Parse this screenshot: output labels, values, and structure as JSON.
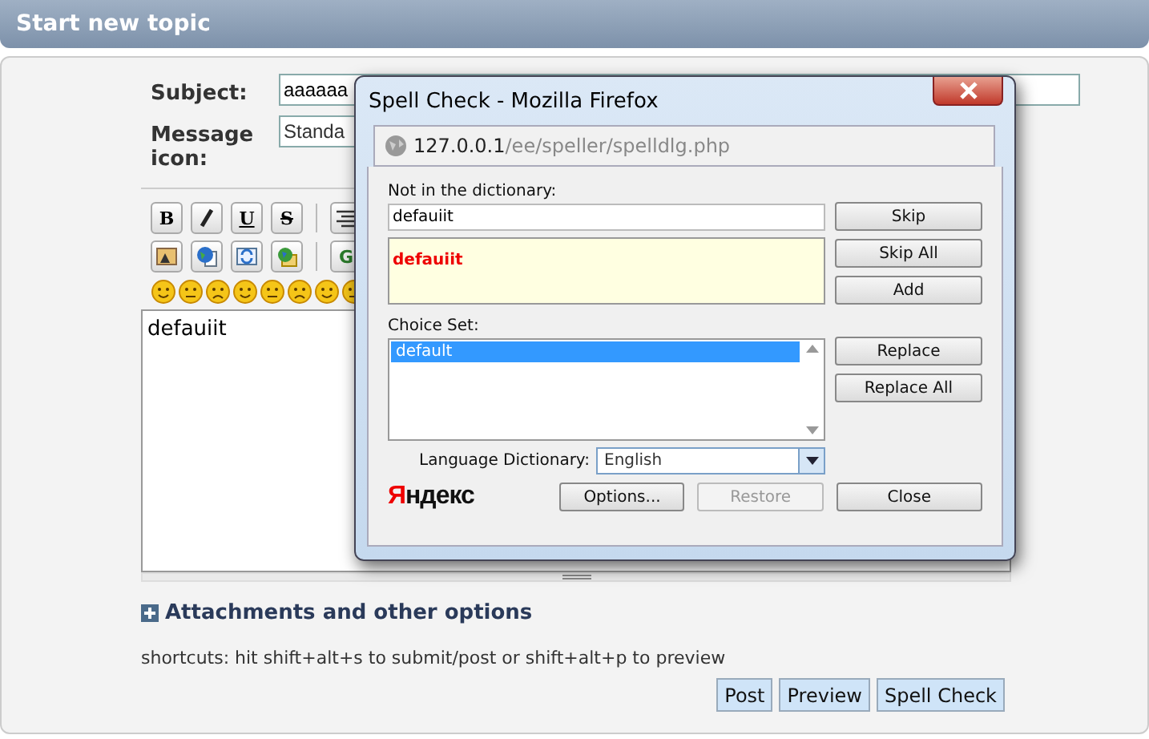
{
  "header": {
    "title": "Start new topic"
  },
  "form": {
    "subject_label": "Subject:",
    "subject_value": "aaaaaa",
    "icon_label": "Message icon:",
    "icon_value": "Standa"
  },
  "toolbar": {
    "format_buttons": [
      "B",
      "U",
      "S"
    ],
    "letter_button": "G"
  },
  "editor": {
    "value": "defauiit"
  },
  "attachments": {
    "label": "Attachments and other options",
    "expanded": false
  },
  "shortcuts": "shortcuts: hit shift+alt+s to submit/post or shift+alt+p to preview",
  "buttons": [
    "Post",
    "Preview",
    "Spell Check"
  ],
  "dialog": {
    "title": "Spell Check - Mozilla Firefox",
    "url_host": "127.0.0.1",
    "url_path": "/ee/speller/spelldlg.php",
    "not_in_dict_label": "Not in the dictionary:",
    "word_value": "defauiit",
    "context_word": "defauiit",
    "side_buttons": [
      {
        "label": "Skip",
        "disabled": false
      },
      {
        "label": "Skip All",
        "disabled": false
      },
      {
        "label": "Add",
        "disabled": false
      }
    ],
    "choice_label": "Choice Set:",
    "choices": [
      {
        "label": "default",
        "selected": true
      }
    ],
    "replace_buttons": [
      {
        "label": "Replace",
        "disabled": false
      },
      {
        "label": "Replace All",
        "disabled": false
      }
    ],
    "language_label": "Language Dictionary:",
    "language_value": "English",
    "logo_first": "Я",
    "logo_rest": "ндекс",
    "bottom_buttons": [
      {
        "label": "Options...",
        "disabled": false
      },
      {
        "label": "Restore",
        "disabled": true
      },
      {
        "label": "Close",
        "disabled": false
      }
    ]
  }
}
